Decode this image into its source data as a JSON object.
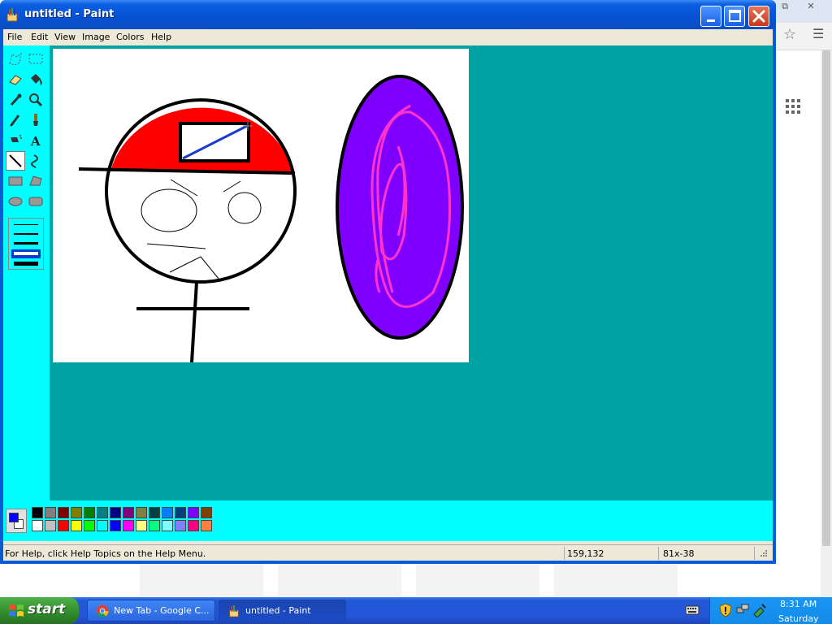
{
  "window": {
    "title": "untitled - Paint",
    "menu": [
      "File",
      "Edit",
      "View",
      "Image",
      "Colors",
      "Help"
    ]
  },
  "tools": [
    {
      "name": "free-form-select-tool"
    },
    {
      "name": "select-tool"
    },
    {
      "name": "eraser-tool"
    },
    {
      "name": "fill-tool"
    },
    {
      "name": "pick-color-tool"
    },
    {
      "name": "magnifier-tool"
    },
    {
      "name": "pencil-tool"
    },
    {
      "name": "brush-tool"
    },
    {
      "name": "airbrush-tool"
    },
    {
      "name": "text-tool"
    },
    {
      "name": "line-tool",
      "selected": true
    },
    {
      "name": "curve-tool"
    },
    {
      "name": "rectangle-tool"
    },
    {
      "name": "polygon-tool"
    },
    {
      "name": "ellipse-tool"
    },
    {
      "name": "rounded-rectangle-tool"
    }
  ],
  "palette": {
    "foreground": "#0000ff",
    "background": "#ffffff",
    "row1": [
      "#000000",
      "#808080",
      "#800000",
      "#808000",
      "#008000",
      "#008080",
      "#000080",
      "#800080",
      "#808040",
      "#004040",
      "#0080ff",
      "#004080",
      "#8000ff",
      "#804000"
    ],
    "row2": [
      "#ffffff",
      "#c0c0c0",
      "#ff0000",
      "#ffff00",
      "#00ff00",
      "#00ffff",
      "#0000ff",
      "#ff00ff",
      "#ffff80",
      "#00ff80",
      "#80ffff",
      "#8080ff",
      "#ff0080",
      "#ff8040"
    ]
  },
  "status": {
    "help_text": "For Help, click Help Topics on the Help Menu.",
    "coords": "159,132",
    "size": "81x-38"
  },
  "taskbar": {
    "start_label": "start",
    "tasks": [
      {
        "label": "New Tab - Google C...",
        "active": false
      },
      {
        "label": "untitled - Paint",
        "active": true
      }
    ],
    "clock_time": "8:31 AM",
    "clock_day": "Saturday"
  }
}
